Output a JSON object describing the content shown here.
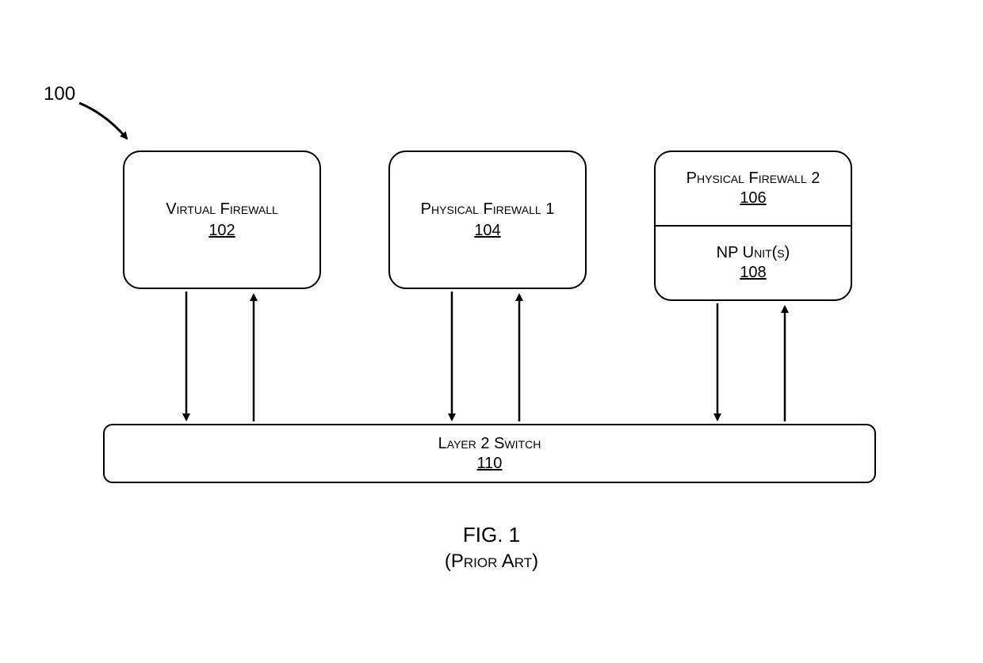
{
  "figure_reference": "100",
  "boxes": {
    "virtual_firewall": {
      "title": "Virtual Firewall",
      "ref": "102"
    },
    "physical_firewall_1": {
      "title": "Physical Firewall 1",
      "ref": "104"
    },
    "physical_firewall_2": {
      "title": "Physical Firewall 2",
      "ref": "106"
    },
    "np_units": {
      "title": "NP Unit(s)",
      "ref": "108"
    },
    "layer2_switch": {
      "title": "Layer 2 Switch",
      "ref": "110"
    }
  },
  "caption": {
    "fig": "FIG. 1",
    "sub": "(Prior Art)"
  }
}
